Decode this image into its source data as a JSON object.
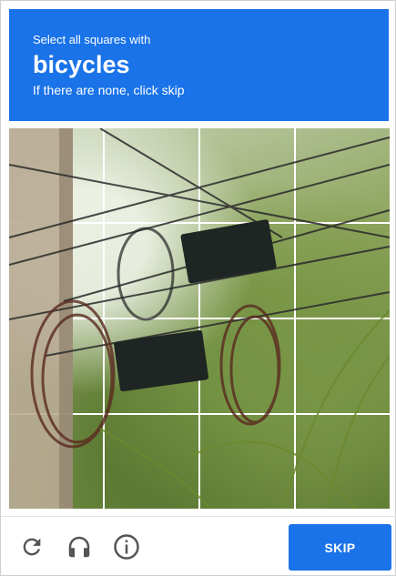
{
  "challenge": {
    "instruction": "Select all squares with",
    "target": "bicycles",
    "hint": "If there are none, click skip"
  },
  "grid": {
    "rows": 4,
    "cols": 4
  },
  "footer": {
    "refresh_icon": "refresh-icon",
    "audio_icon": "headphones-icon",
    "info_icon": "info-icon",
    "skip_label": "SKIP"
  },
  "colors": {
    "accent": "#1a73e8",
    "icon": "#555555"
  }
}
